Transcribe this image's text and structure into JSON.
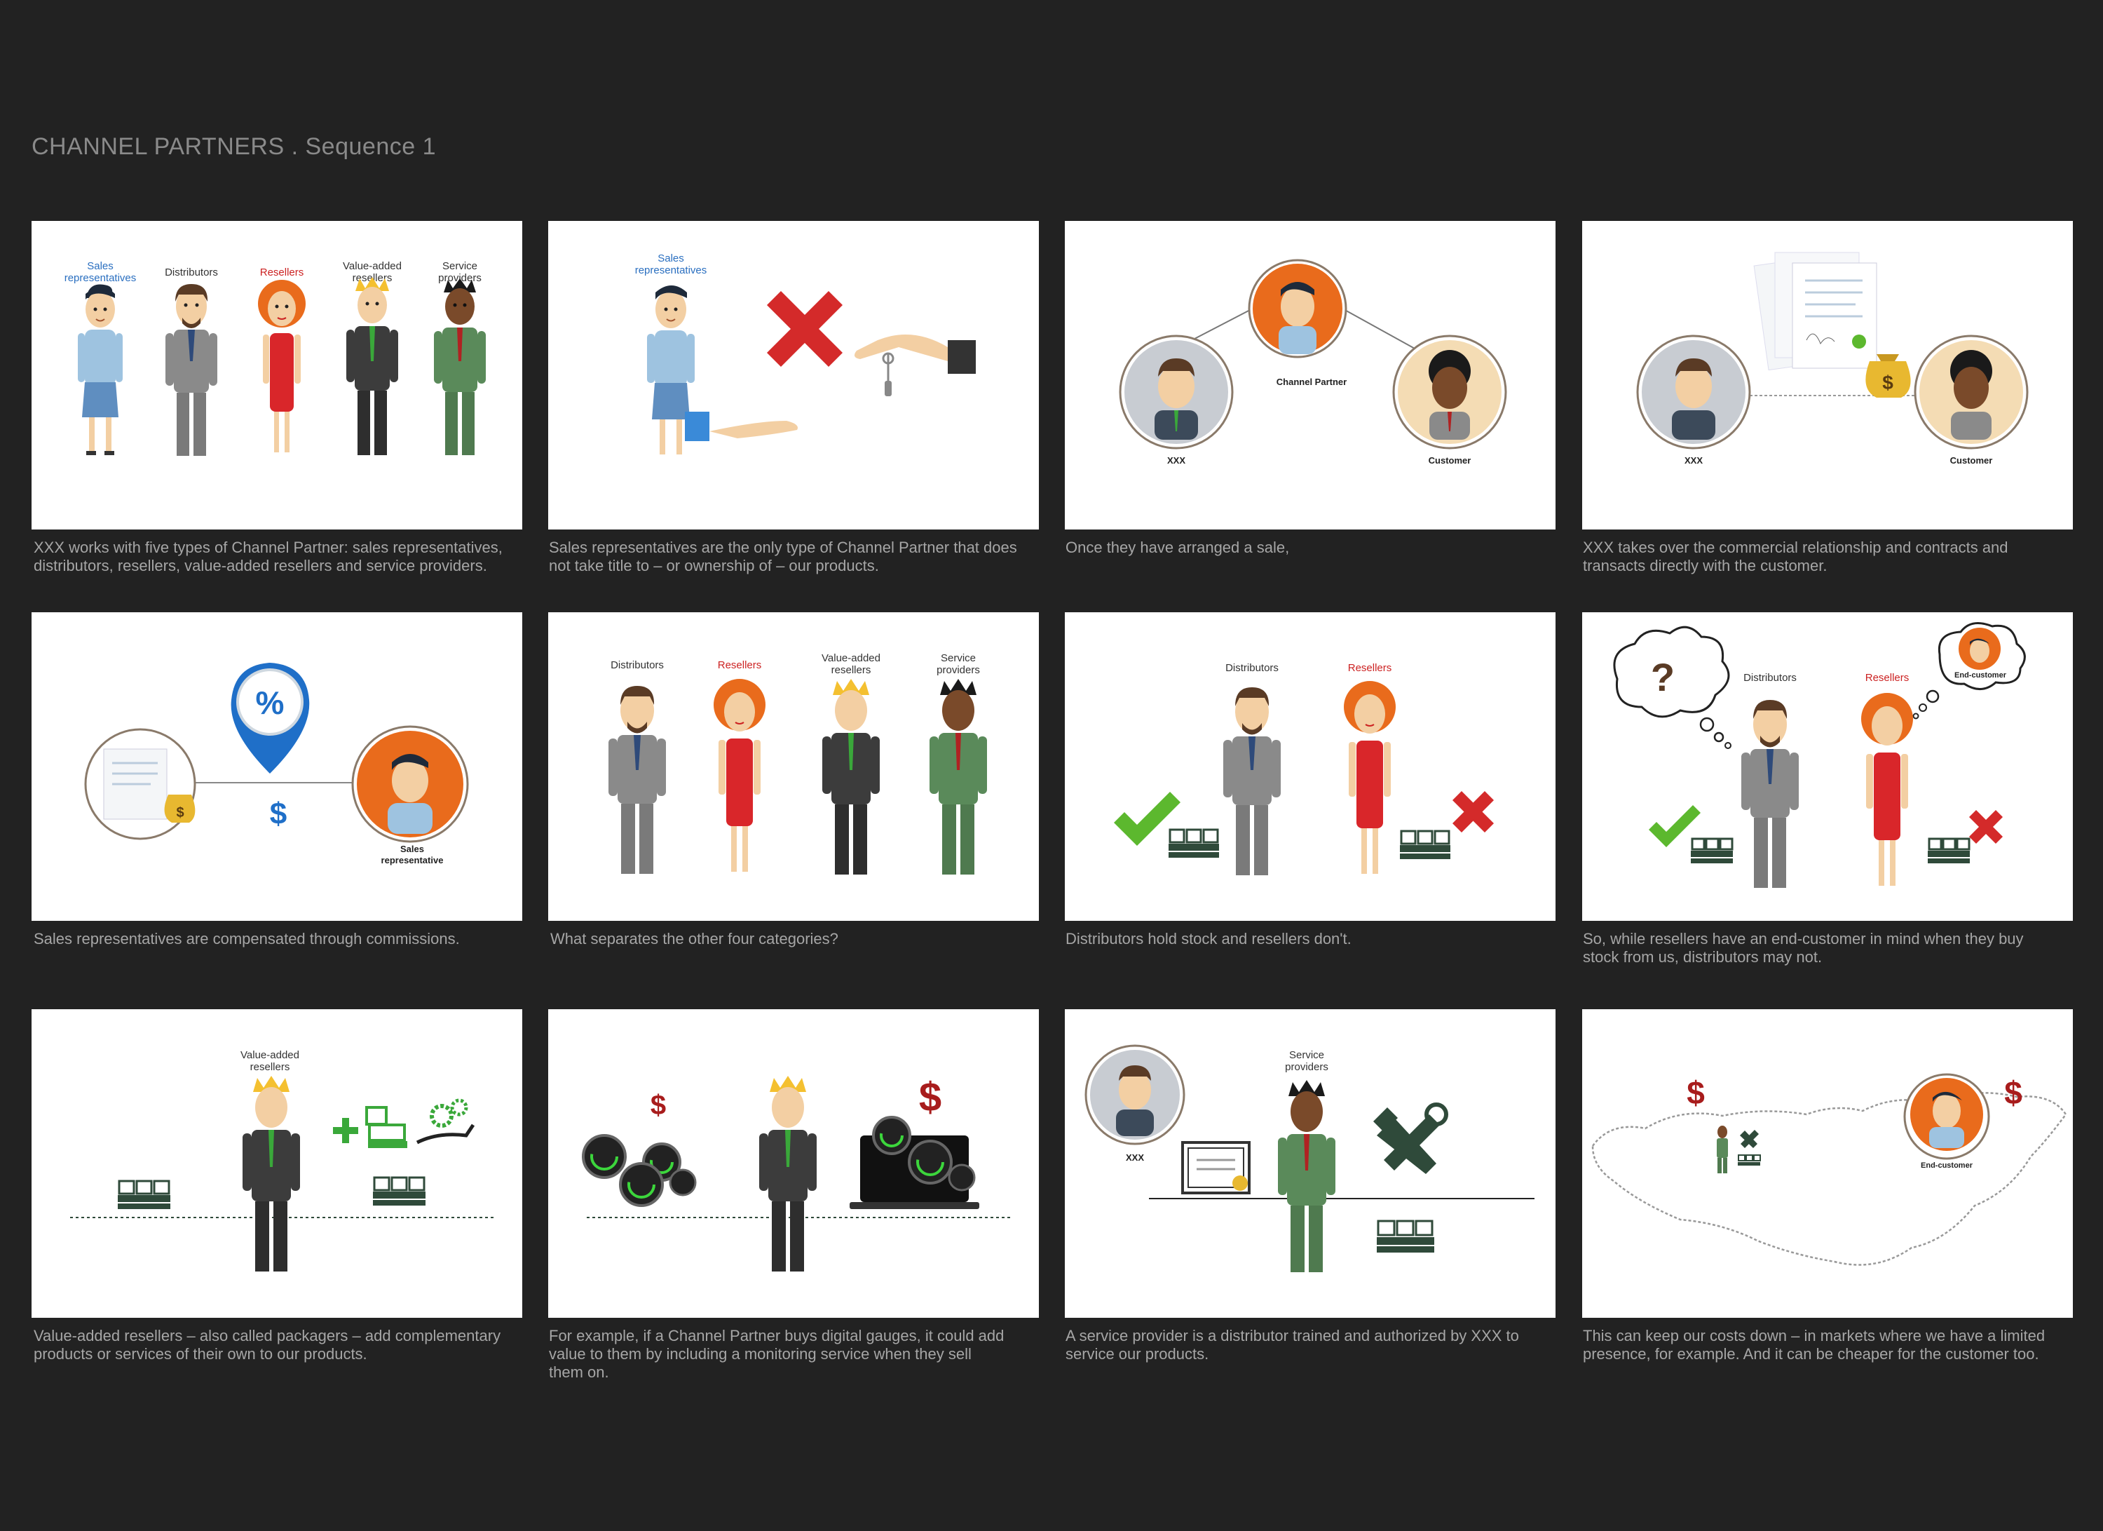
{
  "page_title": "CHANNEL PARTNERS . Sequence 1",
  "colors": {
    "background": "#222222",
    "caption_text": "#a6a6a6",
    "label_blue": "#2a6fc0",
    "label_red": "#cc2222",
    "check_green": "#5cb82e",
    "cross_red": "#d42a2a",
    "dollar_red": "#a81c1c",
    "commission_blue": "#1f6fc8",
    "avatar_orange": "#e96b1c"
  },
  "panels": [
    {
      "labels": [
        "Sales",
        "representatives",
        "Distributors",
        "Resellers",
        "Value-added",
        "resellers",
        "Service",
        "providers"
      ],
      "caption": [
        "XXX works with five types of Channel Partner: sales representatives,",
        "distributors, resellers, value-added resellers and service providers."
      ]
    },
    {
      "labels": [
        "Sales",
        "representatives"
      ],
      "caption": [
        "Sales representatives are the only type of Channel Partner that does",
        "not take title to – or ownership of – our products."
      ]
    },
    {
      "labels": [
        "Channel Partner",
        "XXX",
        "Customer"
      ],
      "caption": [
        "Once they have arranged a sale,",
        ""
      ]
    },
    {
      "labels": [
        "XXX",
        "Customer"
      ],
      "caption": [
        "XXX takes over the commercial relationship and contracts and",
        "transacts directly with the customer."
      ]
    },
    {
      "labels": [
        "%",
        "$",
        "Sales",
        "representative"
      ],
      "caption": [
        "Sales representatives are compensated through commissions.",
        ""
      ]
    },
    {
      "labels": [
        "Distributors",
        "Resellers",
        "Value-added",
        "resellers",
        "Service",
        "providers"
      ],
      "caption": [
        "What separates the other four categories?",
        ""
      ]
    },
    {
      "labels": [
        "Distributors",
        "Resellers"
      ],
      "caption": [
        "Distributors hold stock and resellers don't.",
        ""
      ]
    },
    {
      "labels": [
        "?",
        "Distributors",
        "Resellers",
        "End-customer"
      ],
      "caption": [
        "So, while resellers have an end-customer in mind when they buy",
        "stock from us, distributors may not."
      ]
    },
    {
      "labels": [
        "Value-added",
        "resellers"
      ],
      "caption": [
        "Value-added resellers – also called packagers – add complementary",
        "products or services of their own to our products."
      ]
    },
    {
      "labels": [
        "$",
        "$"
      ],
      "caption": [
        "For example, if a Channel Partner buys digital gauges, it could add",
        "value to them by including a monitoring service when they sell",
        "them on."
      ]
    },
    {
      "labels": [
        "Service",
        "providers",
        "XXX"
      ],
      "caption": [
        "A service provider is a distributor trained and authorized by XXX to",
        "service our products."
      ]
    },
    {
      "labels": [
        "$",
        "$",
        "End-customer"
      ],
      "caption": [
        "This can keep our costs down – in markets where we have a limited",
        "presence, for example. And it can be cheaper for the customer too."
      ]
    }
  ]
}
